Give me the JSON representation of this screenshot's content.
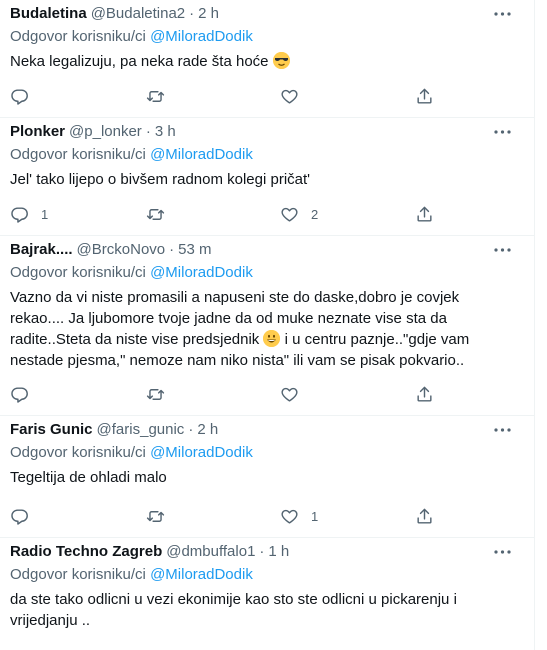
{
  "reply_prefix": "Odgovor korisniku/ci",
  "colors": {
    "text": "#0f1419",
    "secondary": "#536471",
    "link": "#1d9bf0"
  },
  "tweets": [
    {
      "name": "Budaletina",
      "handle": "@Budaletina2",
      "time": "2 h",
      "mention": "@MiloradDodik",
      "text": "Neka legalizuju, pa neka rade šta hoće",
      "emoji": "smiling-face-with-sunglasses",
      "replies": "",
      "retweets": "",
      "likes": ""
    },
    {
      "name": "Plonker",
      "handle": "@p_lonker",
      "time": "3 h",
      "mention": "@MiloradDodik",
      "text": "Jel' tako lijepo o bivšem radnom kolegi pričat'",
      "replies": "1",
      "retweets": "",
      "likes": "2"
    },
    {
      "name": "Bajrak....",
      "handle": "@BrckoNovo",
      "time": "53 m",
      "mention": "@MiloradDodik",
      "text_part1": "Vazno da vi niste promasili a napuseni ste  do daske,dobro je covjek rekao.... Ja ljubomore tvoje jadne da  od muke neznate vise sta da radite..Steta da niste vise predsjednik",
      "emoji": "grinning-face",
      "text_part2": " i u centru paznje..\"gdje  vam nestade pjesma,\" nemoze nam niko nista\" ili vam se pisak pokvario..",
      "replies": "",
      "retweets": "",
      "likes": ""
    },
    {
      "name": "Faris Gunic",
      "handle": "@faris_gunic",
      "time": "2 h",
      "mention": "@MiloradDodik",
      "text": "Tegeltija de ohladi malo",
      "replies": "",
      "retweets": "",
      "likes": "1"
    },
    {
      "name": "Radio Techno Zagreb",
      "handle": "@dmbuffalo1",
      "time": "1 h",
      "mention": "@MiloradDodik",
      "text": "da ste tako odlicni u vezi ekonimije kao sto ste odlicni u pickarenju i vrijedjanju .."
    }
  ]
}
